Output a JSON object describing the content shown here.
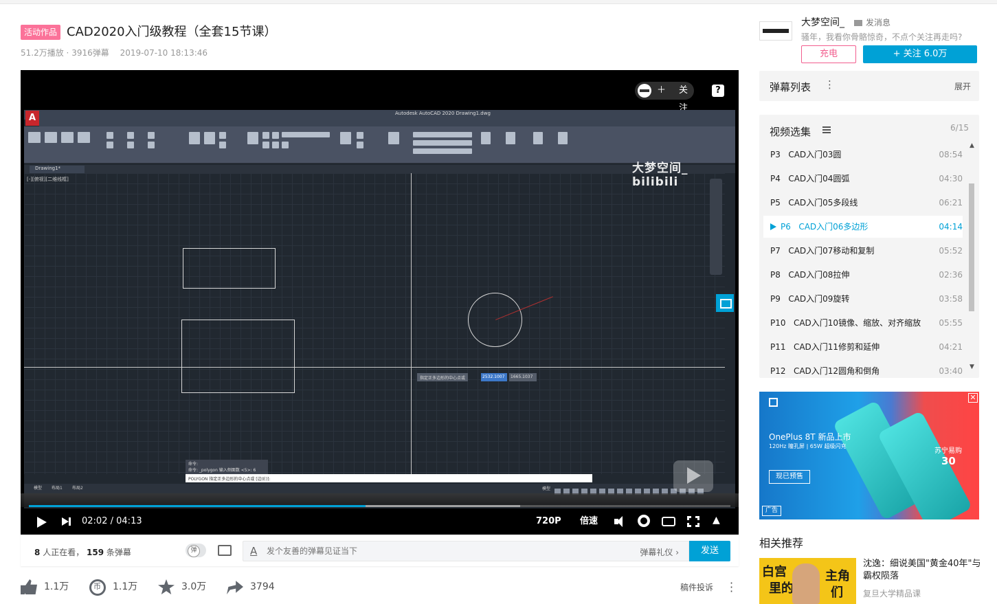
{
  "video": {
    "tag": "活动作品",
    "title": "CAD2020入门级教程（全套15节课）",
    "plays": "51.2万播放",
    "danmaku_count": "3916弹幕",
    "date": "2019-07-10 18:13:46"
  },
  "player": {
    "follow_label": "关注",
    "help_label": "?",
    "watermark": "大梦空间_ bilibili",
    "acad_window_title": "Autodesk AutoCAD 2020   Drawing1.dwg",
    "drawing_tab": "Drawing1*",
    "view_label": "[-][俯视][二维线框]",
    "tooltip_text": "指定正多边形的中心点或",
    "coord_x": "2532.1007",
    "coord_y": "1665.1037",
    "cmd_history_1": "命令:",
    "cmd_history_2": "命令: _polygon 输入侧面数 <5>: 6",
    "cmd_line": "POLYGON 指定正多边形的中心点或 [边(E)]:",
    "layout_tabs": [
      "模型",
      "布局1",
      "布局2"
    ],
    "status_model": "模型",
    "current_time": "02:02",
    "total_time": "04:13",
    "time_separator": "/",
    "progress": 0.48,
    "buffered": 0.7,
    "quality": "720P",
    "speed": "倍速"
  },
  "danmaku_bar": {
    "viewers_count": "8",
    "viewers_label": "人正在看，",
    "danmaku_count": "159",
    "danmaku_label": "条弹幕",
    "toggle_label": "弹",
    "placeholder": "发个友善的弹幕见证当下",
    "etiquette": "弹幕礼仪 ›",
    "send": "发送"
  },
  "toolbar": {
    "like": "1.1万",
    "coin": "1.1万",
    "favorite": "3.0万",
    "share": "3794",
    "report": "稿件投诉"
  },
  "uploader": {
    "name": "大梦空间_",
    "message": "发消息",
    "desc": "骚年，我看你骨骼惊奇，不点个关注再走吗?",
    "charge": "充电",
    "follow": "+ 关注 6.0万"
  },
  "danmaku_list": {
    "title": "弹幕列表",
    "expand": "展开"
  },
  "episodes": {
    "title": "视频选集",
    "count": "6/15",
    "items": [
      {
        "code": "P3",
        "name": "CAD入门03圆",
        "duration": "08:54"
      },
      {
        "code": "P4",
        "name": "CAD入门04圆弧",
        "duration": "04:30"
      },
      {
        "code": "P5",
        "name": "CAD入门05多段线",
        "duration": "06:21"
      },
      {
        "code": "P6",
        "name": "CAD入门06多边形",
        "duration": "04:14"
      },
      {
        "code": "P7",
        "name": "CAD入门07移动和复制",
        "duration": "05:52"
      },
      {
        "code": "P8",
        "name": "CAD入门08拉伸",
        "duration": "02:36"
      },
      {
        "code": "P9",
        "name": "CAD入门09旋转",
        "duration": "03:58"
      },
      {
        "code": "P10",
        "name": "CAD入门10镜像、缩放、对齐缩放",
        "duration": "05:55"
      },
      {
        "code": "P11",
        "name": "CAD入门11修剪和延伸",
        "duration": "04:21"
      },
      {
        "code": "P12",
        "name": "CAD入门12圆角和倒角",
        "duration": "03:40"
      }
    ]
  },
  "ad": {
    "title": "OnePlus 8T 新品上市",
    "subtitle": "120Hz 瞳孔屏 | 65W 超级闪充",
    "button": "现已预售",
    "tag": "广告",
    "suning": "苏宁易购",
    "suning_num": "30"
  },
  "related": {
    "heading": "相关推荐",
    "thumb_text_1": "白宫",
    "thumb_text_2": "里的",
    "thumb_text_3": "主角",
    "thumb_text_4": "们",
    "title": "沈逸：细说美国\"黄金40年\"与霸权陨落",
    "up": "复旦大学精品课"
  }
}
